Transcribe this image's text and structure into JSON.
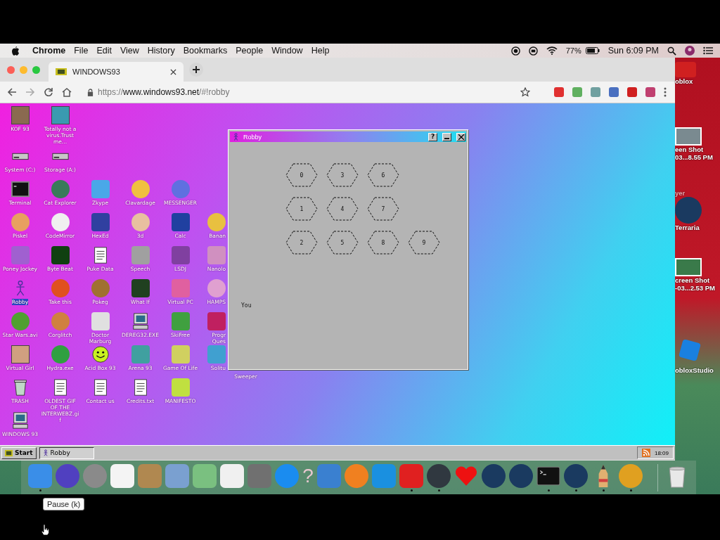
{
  "menu_bar": {
    "app": "Chrome",
    "menus": [
      "File",
      "Edit",
      "View",
      "History",
      "Bookmarks",
      "People",
      "Window",
      "Help"
    ],
    "battery_percent": "77%",
    "clock": "Sun 6:09 PM"
  },
  "browser": {
    "tab_title": "WINDOWS93",
    "url": {
      "scheme": "https://",
      "host": "www.windows93.net",
      "path": "/#!robby"
    },
    "extensions": [
      {
        "color": "#e03030"
      },
      {
        "color": "#60b060"
      },
      {
        "color": "#70a0a0"
      },
      {
        "color": "#4a70c0"
      },
      {
        "color": "#d02020"
      },
      {
        "color": "#c04070"
      }
    ]
  },
  "desktop": {
    "rows": [
      [
        {
          "label": "KOF 93",
          "kind": "photo",
          "color": "#8a6a50",
          "selected": false
        },
        {
          "label": "Totally not a virus.Trust me...",
          "kind": "photo",
          "color": "#3a9ab0",
          "selected": false
        }
      ],
      [
        {
          "label": "System (C:)",
          "kind": "drive",
          "selected": false
        },
        {
          "label": "Storage (A:)",
          "kind": "drive",
          "selected": false
        }
      ],
      [
        {
          "label": "Terminal",
          "kind": "terminal",
          "selected": false
        },
        {
          "label": "Cat Explorer",
          "kind": "circle",
          "color": "#3a7a5a",
          "selected": false
        },
        {
          "label": "Zkype",
          "kind": "tile",
          "color": "#4aa8e8",
          "selected": false
        },
        {
          "label": "Clavardage",
          "kind": "circle",
          "color": "#f0c040",
          "selected": false
        },
        {
          "label": "MESSENGER",
          "kind": "circle",
          "color": "#6070e0",
          "selected": false
        }
      ],
      [
        {
          "label": "Piskel",
          "kind": "circle",
          "color": "#e8a060",
          "selected": false
        },
        {
          "label": "CodeMirror",
          "kind": "circle",
          "color": "#f0f0f0",
          "selected": false
        },
        {
          "label": "HexEd",
          "kind": "tile",
          "color": "#3040a0",
          "selected": false
        },
        {
          "label": "3d",
          "kind": "circle",
          "color": "#e8c0a0",
          "selected": false
        },
        {
          "label": "Calc",
          "kind": "tile",
          "color": "#2040a0",
          "selected": false
        },
        {
          "label": "Banan",
          "kind": "circle",
          "color": "#e8c040",
          "selected": false
        }
      ],
      [
        {
          "label": "Poney Jockey",
          "kind": "tile",
          "color": "#a060d0",
          "selected": false
        },
        {
          "label": "Byte Beat",
          "kind": "tile",
          "color": "#104010",
          "selected": false
        },
        {
          "label": "Puke Data",
          "kind": "document",
          "selected": false
        },
        {
          "label": "Speech",
          "kind": "tile",
          "color": "#a0a0a0",
          "selected": false
        },
        {
          "label": "LSDJ",
          "kind": "tile",
          "color": "#8040a0",
          "selected": false
        },
        {
          "label": "Nanolo",
          "kind": "tile",
          "color": "#d090c0",
          "selected": false
        }
      ],
      [
        {
          "label": "Robby",
          "kind": "figure",
          "selected": true
        },
        {
          "label": "Take this",
          "kind": "circle",
          "color": "#e05020",
          "selected": false
        },
        {
          "label": "Pokeg",
          "kind": "circle",
          "color": "#a07030",
          "selected": false
        },
        {
          "label": "What If",
          "kind": "tile",
          "color": "#204020",
          "selected": false
        },
        {
          "label": "Virtual PC",
          "kind": "tile",
          "color": "#e060a0",
          "selected": false
        },
        {
          "label": "HAMPS",
          "kind": "circle",
          "color": "#e0a0d0",
          "selected": false
        }
      ],
      [
        {
          "label": "Star Wars.avi",
          "kind": "circle",
          "color": "#50a030",
          "selected": false
        },
        {
          "label": "Corglitch",
          "kind": "circle",
          "color": "#d08040",
          "selected": false
        },
        {
          "label": "Doctor Marburg",
          "kind": "tile",
          "color": "#e0e0e0",
          "selected": false
        },
        {
          "label": "DEREG32.EXE",
          "kind": "computer",
          "selected": false
        },
        {
          "label": "SkiFree",
          "kind": "tile",
          "color": "#40a040",
          "selected": false
        },
        {
          "label": "Progr Ques",
          "kind": "tile",
          "color": "#c02060",
          "selected": false
        }
      ],
      [
        {
          "label": "Virtual Girl",
          "kind": "photo",
          "color": "#d0a080",
          "selected": false
        },
        {
          "label": "Hydra.exe",
          "kind": "circle",
          "color": "#30a040",
          "selected": false
        },
        {
          "label": "Acid Box 93",
          "kind": "smiley",
          "selected": false
        },
        {
          "label": "Arena 93",
          "kind": "tile",
          "color": "#40a0a0",
          "selected": false
        },
        {
          "label": "Game Of Life",
          "kind": "tile",
          "color": "#d0d060",
          "selected": false
        },
        {
          "label": "Solitu",
          "kind": "tile",
          "color": "#40a0d0",
          "selected": false
        },
        {
          "label": "Sweeper",
          "kind": "covered",
          "selected": false
        }
      ],
      [
        {
          "label": "TRASH",
          "kind": "trash",
          "selected": false
        },
        {
          "label": "OLDEST GIF OF THE INTERWEBZ.gif",
          "kind": "document",
          "selected": false
        },
        {
          "label": "Contact us",
          "kind": "document",
          "selected": false
        },
        {
          "label": "Credits.txt",
          "kind": "document",
          "selected": false
        },
        {
          "label": "MANIFESTO",
          "kind": "tile",
          "color": "#c0e040",
          "selected": false
        }
      ],
      [
        {
          "label": "WINDOWS 93",
          "kind": "computer",
          "selected": false
        }
      ]
    ]
  },
  "robby_window": {
    "title": "Robby",
    "tiles": [
      [
        "0",
        "3",
        "6"
      ],
      [
        "1",
        "4",
        "7"
      ],
      [
        "2",
        "5",
        "8",
        "9"
      ]
    ],
    "player_label": "You",
    "help_button": "?"
  },
  "taskbar": {
    "start": "Start",
    "task": "Robby",
    "clock": "18:09"
  },
  "mac_desktop": {
    "items": [
      {
        "kind": "tile",
        "color": "#d02020",
        "lines": [
          "oblox"
        ]
      },
      {
        "kind": "photo",
        "color": "#7a8a90",
        "lines": [
          "een Shot",
          "03...8.55 PM"
        ]
      },
      {
        "kind": "none",
        "lines": [
          "yer"
        ]
      },
      {
        "kind": "circle",
        "color": "#1a3a60",
        "lines": [
          "Terraria"
        ]
      },
      {
        "kind": "photo",
        "color": "#3a7a4a",
        "lines": [
          "creen Shot",
          "-03...2.53 PM"
        ]
      },
      {
        "kind": "tile",
        "color": "#1a80e0",
        "lines": [
          "obloxStudio"
        ]
      }
    ]
  },
  "dock": {
    "items": [
      {
        "kind": "tile",
        "color": "#3a8ee8",
        "running": true
      },
      {
        "kind": "circle",
        "color": "#5040c0",
        "running": false
      },
      {
        "kind": "circle",
        "color": "#8a8a8a",
        "running": false
      },
      {
        "kind": "tile",
        "color": "#f4f4f4",
        "running": false
      },
      {
        "kind": "tile",
        "color": "#b08850",
        "running": false
      },
      {
        "kind": "tile",
        "color": "#7aa0d0",
        "running": false
      },
      {
        "kind": "tile",
        "color": "#7ac080",
        "running": false
      },
      {
        "kind": "tile",
        "color": "#f0f0f0",
        "running": false
      },
      {
        "kind": "tile",
        "color": "#707070",
        "running": false
      },
      {
        "kind": "circle",
        "color": "#1a8cf0",
        "running": false
      },
      {
        "kind": "glyph",
        "glyph": "?",
        "running": false
      },
      {
        "kind": "tile",
        "color": "#3a80d0",
        "running": false
      },
      {
        "kind": "circle",
        "color": "#f08020",
        "running": false
      },
      {
        "kind": "tile",
        "color": "#1a90e0",
        "running": false
      },
      {
        "kind": "tile",
        "color": "#e02020",
        "running": true
      },
      {
        "kind": "circle",
        "color": "#303840",
        "running": true
      },
      {
        "kind": "heart",
        "color": "#ee1111",
        "running": false
      },
      {
        "kind": "circle",
        "color": "#1a3a60",
        "running": false
      },
      {
        "kind": "circle",
        "color": "#1a3a60",
        "running": false
      },
      {
        "kind": "terminal",
        "running": true
      },
      {
        "kind": "circle",
        "color": "#1a3a60",
        "running": true
      },
      {
        "kind": "pencil",
        "running": true
      },
      {
        "kind": "circle",
        "color": "#e0a020",
        "running": true
      },
      {
        "kind": "trash",
        "running": false
      }
    ]
  },
  "tooltip": "Pause (k)"
}
